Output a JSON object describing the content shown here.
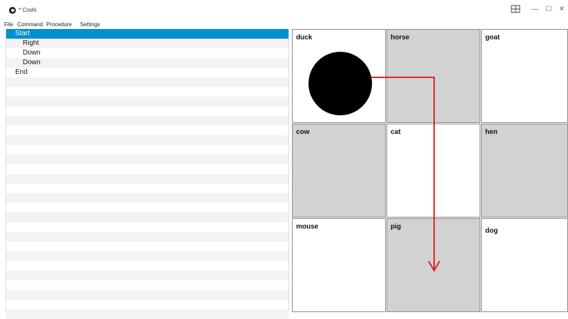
{
  "window": {
    "title": "* Coshi"
  },
  "menu": [
    "File",
    "Command",
    "Procedure",
    "Settings"
  ],
  "program": {
    "lines": [
      {
        "text": "Start",
        "indent": 0,
        "selected": true
      },
      {
        "text": "Right",
        "indent": 1,
        "selected": false
      },
      {
        "text": "Down",
        "indent": 1,
        "selected": false
      },
      {
        "text": "Down",
        "indent": 1,
        "selected": false
      },
      {
        "text": "End",
        "indent": 0,
        "selected": false
      }
    ]
  },
  "grid": {
    "cells": [
      {
        "label": "duck",
        "shade": "white"
      },
      {
        "label": "horse",
        "shade": "gray"
      },
      {
        "label": "goat",
        "shade": "white"
      },
      {
        "label": "cow",
        "shade": "gray"
      },
      {
        "label": "cat",
        "shade": "white"
      },
      {
        "label": "hen",
        "shade": "gray"
      },
      {
        "label": "mouse",
        "shade": "white"
      },
      {
        "label": "pig",
        "shade": "gray"
      },
      {
        "label": "dog",
        "shade": "white"
      }
    ],
    "robot_cell": "duck",
    "path_color": "#e02020"
  },
  "icons": {
    "layout": "layout-icon",
    "minimize": "minimize-icon",
    "maximize": "maximize-icon",
    "close": "close-icon"
  }
}
